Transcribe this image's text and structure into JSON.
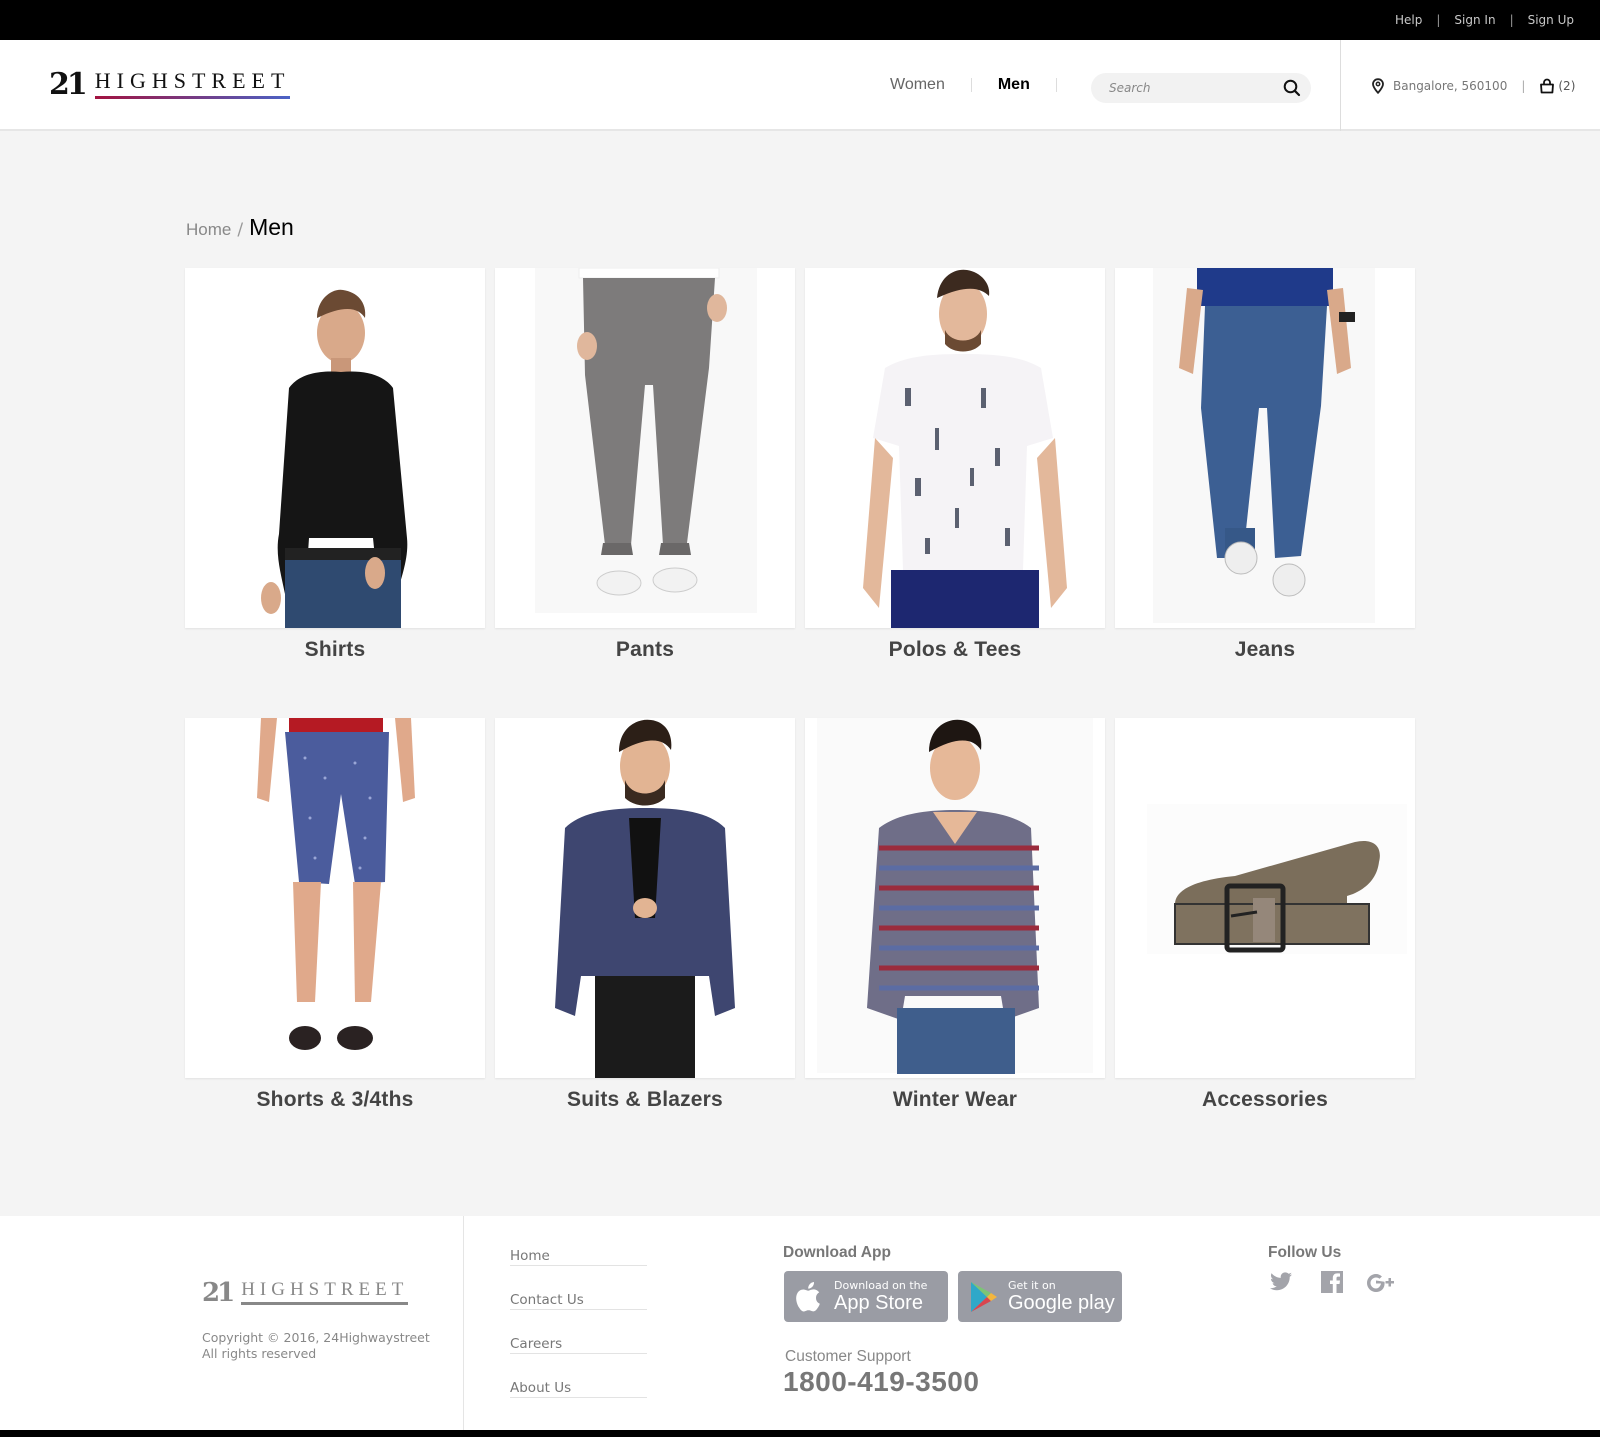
{
  "topbar": {
    "links": [
      {
        "label": "Help"
      },
      {
        "label": "Sign In"
      },
      {
        "label": "Sign Up"
      }
    ],
    "separator": "|"
  },
  "header": {
    "logo": {
      "number": "21",
      "word": "HIGHSTREET"
    },
    "nav": [
      {
        "label": "Women",
        "active": false
      },
      {
        "label": "Men",
        "active": true
      }
    ],
    "search": {
      "placeholder": "Search",
      "value": "",
      "icon": "search-icon"
    },
    "location": {
      "icon": "map-pin-icon",
      "text": "Bangalore, 560100"
    },
    "separator": "|",
    "cart": {
      "icon": "shopping-bag-icon",
      "count": "(2)"
    }
  },
  "breadcrumb": {
    "home": "Home",
    "separator": "/",
    "current": "Men"
  },
  "categories": [
    {
      "label": "Shirts",
      "image": "man in black shirt"
    },
    {
      "label": "Pants",
      "image": "grey chino pants"
    },
    {
      "label": "Polos & Tees",
      "image": "white printed t-shirt"
    },
    {
      "label": "Jeans",
      "image": "blue denim jeans"
    },
    {
      "label": "Shorts & 3/4ths",
      "image": "blue dotted shorts"
    },
    {
      "label": "Suits & Blazers",
      "image": "navy textured blazer"
    },
    {
      "label": "Winter Wear",
      "image": "striped sweater"
    },
    {
      "label": "Accessories",
      "image": "brown leather belt"
    }
  ],
  "footer": {
    "logo": {
      "number": "21",
      "word": "HIGHSTREET"
    },
    "copyright_line1": "Copyright © 2016, 24Highwaystreet",
    "copyright_line2": "All rights reserved",
    "links": [
      {
        "label": "Home"
      },
      {
        "label": "Contact Us"
      },
      {
        "label": "Careers"
      },
      {
        "label": "About Us"
      }
    ],
    "download_title": "Download App",
    "app_store": {
      "small": "Download on the",
      "big": "App Store"
    },
    "google_play": {
      "small": "Get it on",
      "big": "Google play"
    },
    "support_label": "Customer Support",
    "support_phone": "1800-419-3500",
    "follow_title": "Follow Us",
    "social": [
      "twitter-icon",
      "facebook-icon",
      "google-plus-icon"
    ]
  },
  "colors": {
    "topbar_bg": "#000000",
    "page_bg": "#f4f4f4",
    "logo_gradient_start": "#a3123f",
    "logo_gradient_end": "#4a63c7",
    "store_button_bg": "#9a9ca4"
  }
}
